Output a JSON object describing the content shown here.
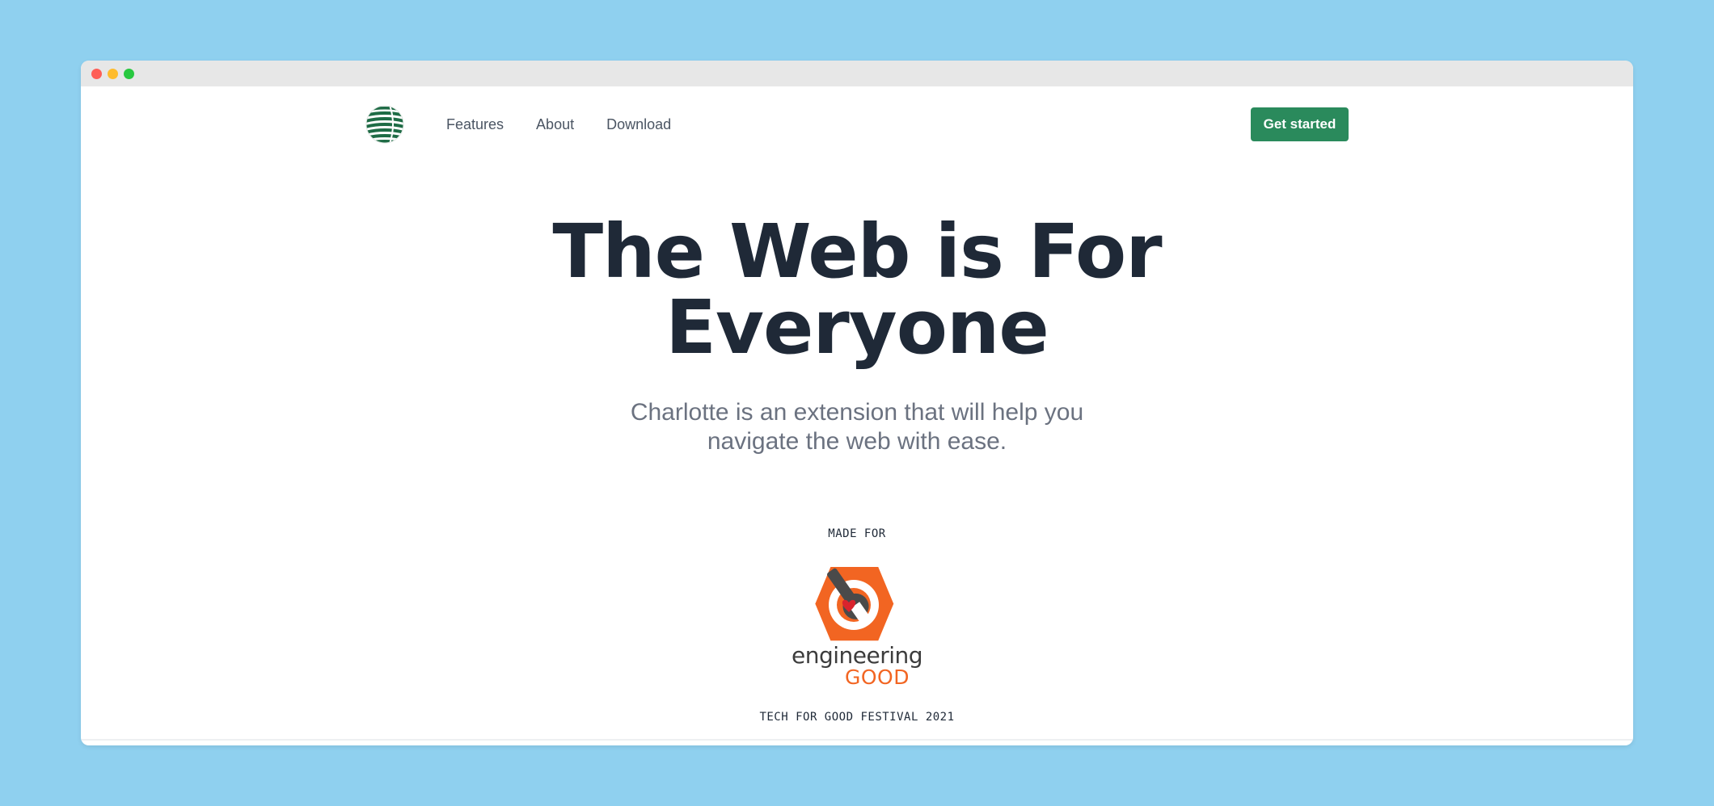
{
  "nav": {
    "links": [
      "Features",
      "About",
      "Download"
    ],
    "cta_label": "Get started"
  },
  "hero": {
    "title_line1": "The Web is For",
    "title_line2": "Everyone",
    "subtitle": "Charlotte is an extension that will help you navigate the web with ease."
  },
  "sponsor": {
    "made_for_label": "MADE FOR",
    "logo_word1": "engineering",
    "logo_word2": "GOOD",
    "event_label": "TECH FOR GOOD FESTIVAL 2021"
  },
  "colors": {
    "background": "#8fd0ef",
    "accent": "#2a8a5c",
    "heading": "#1f2937",
    "muted": "#6b7280",
    "logo_orange": "#f26522"
  },
  "icons": {
    "brand_logo": "striped-globe-icon",
    "sponsor_logo": "engineering-good-logo"
  }
}
